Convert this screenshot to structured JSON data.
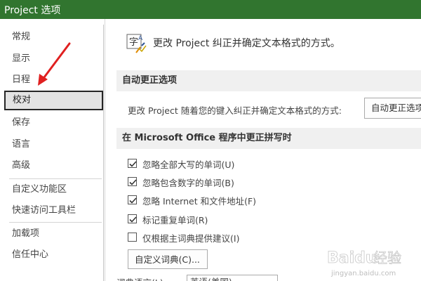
{
  "window": {
    "title": "Project 选项"
  },
  "sidebar": {
    "items": [
      {
        "label": "常规"
      },
      {
        "label": "显示"
      },
      {
        "label": "日程"
      },
      {
        "label": "校对",
        "active": true
      },
      {
        "label": "保存"
      },
      {
        "label": "语言"
      },
      {
        "label": "高级"
      },
      {
        "label": "自定义功能区"
      },
      {
        "label": "快速访问工具栏"
      },
      {
        "label": "加载项"
      },
      {
        "label": "信任中心"
      }
    ]
  },
  "header": {
    "icon": "proofing-abc-icon",
    "text": "更改 Project 纠正并确定文本格式的方式。"
  },
  "autocorrect": {
    "title": "自动更正选项",
    "description": "更改 Project 随着您的键入纠正并确定文本格式的方式:",
    "button_label": "自动更正选项(A)..."
  },
  "spelling": {
    "title": "在 Microsoft Office 程序中更正拼写时",
    "options": [
      {
        "label": "忽略全部大写的单词(U)",
        "checked": true
      },
      {
        "label": "忽略包含数字的单词(B)",
        "checked": true
      },
      {
        "label": "忽略 Internet 和文件地址(F)",
        "checked": true
      },
      {
        "label": "标记重复单词(R)",
        "checked": true
      },
      {
        "label": "仅根据主词典提供建议(I)",
        "checked": false
      }
    ],
    "custom_dict_button": "自定义词典(C)...",
    "dictionary_language_label": "词典语言(L):",
    "dictionary_language_value": "英语(美国)"
  },
  "annotation": {
    "icon": "red-arrow-icon",
    "color": "#e02020"
  },
  "watermark": {
    "brand": "Baidu 经验",
    "url": "jingyan.baidu.com"
  },
  "colors": {
    "titlebar": "#31752f",
    "section_bar": "#f0f0f0",
    "selected_item": "#e3e3e3"
  }
}
